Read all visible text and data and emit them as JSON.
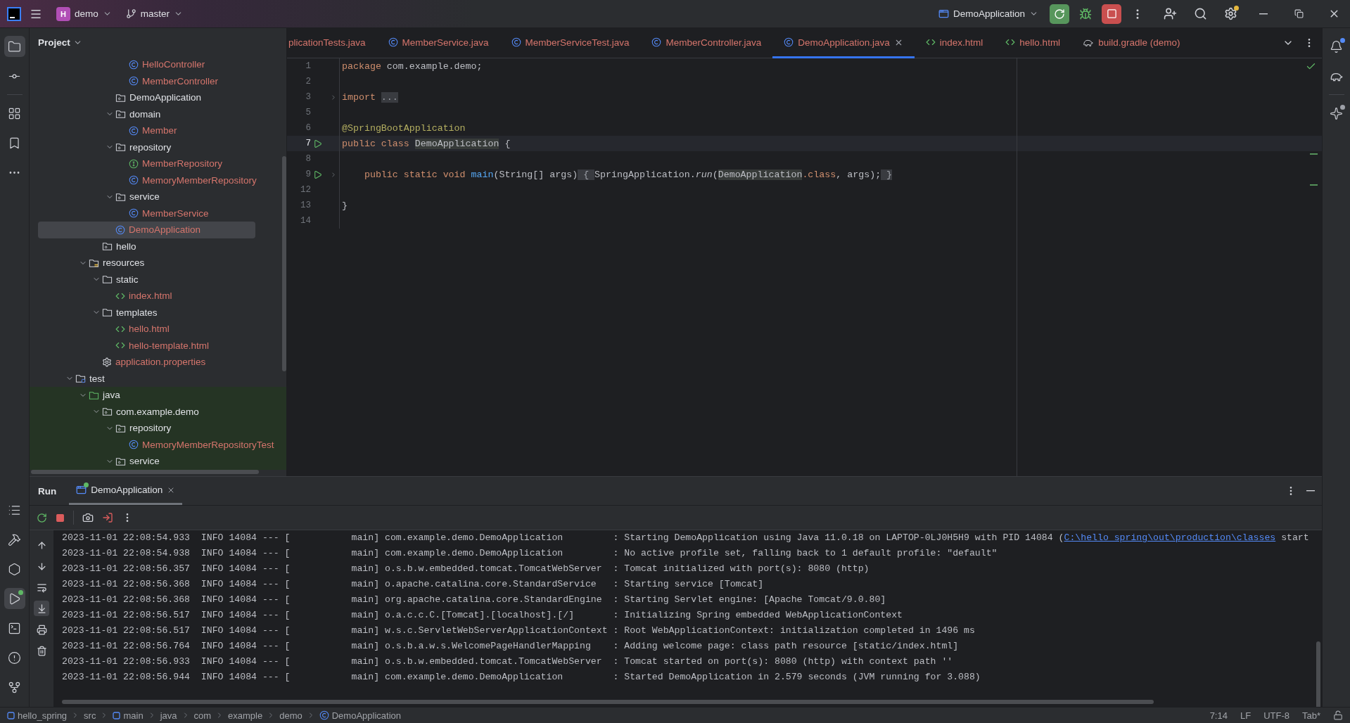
{
  "title_bar": {
    "project_badge": "H",
    "project": "demo",
    "branch": "master",
    "run_config": "DemoApplication"
  },
  "left_tools": [
    {
      "kind": "folder",
      "selected": true,
      "running": false
    },
    {
      "kind": "commit",
      "selected": false,
      "running": false
    },
    {
      "kind": "structure",
      "selected": false,
      "running": false
    },
    {
      "kind": "bookmark",
      "selected": false,
      "running": false
    },
    {
      "kind": "more",
      "selected": false,
      "running": false
    }
  ],
  "left_tools_bottom": [
    {
      "kind": "list",
      "selected": false,
      "running": false
    },
    {
      "kind": "build",
      "selected": false,
      "running": false
    },
    {
      "kind": "services",
      "selected": false,
      "running": false
    },
    {
      "kind": "run",
      "selected": true,
      "running": true
    },
    {
      "kind": "terminal",
      "selected": false,
      "running": false
    },
    {
      "kind": "problems",
      "selected": false,
      "running": false
    },
    {
      "kind": "git",
      "selected": false,
      "running": false
    }
  ],
  "project_panel": {
    "title": "Project",
    "tree": [
      {
        "children": [
          {
            "children": [
              {
                "children": [
                  {
                    "children": [
                      {
                        "label": "HelloController",
                        "kind": "class",
                        "selected": false
                      },
                      {
                        "label": "MemberController",
                        "kind": "class",
                        "selected": false
                      }
                    ]
                  },
                  {
                    "label": "DemoApplication",
                    "kind": "package",
                    "selected": false
                  },
                  {
                    "label": "domain",
                    "kind": "package",
                    "expanded": true,
                    "selected": false,
                    "children": [
                      {
                        "label": "Member",
                        "kind": "class",
                        "selected": false
                      }
                    ]
                  },
                  {
                    "label": "repository",
                    "kind": "package",
                    "expanded": true,
                    "selected": false,
                    "children": [
                      {
                        "label": "MemberRepository",
                        "kind": "interface",
                        "selected": false
                      },
                      {
                        "label": "MemoryMemberRepository",
                        "kind": "class",
                        "selected": false
                      }
                    ]
                  },
                  {
                    "label": "service",
                    "kind": "package",
                    "expanded": true,
                    "selected": false,
                    "children": [
                      {
                        "label": "MemberService",
                        "kind": "class",
                        "selected": false
                      }
                    ]
                  },
                  {
                    "label": "DemoApplication",
                    "kind": "class",
                    "selected": true
                  }
                ]
              },
              {
                "label": "hello",
                "kind": "package",
                "selected": false
              }
            ]
          },
          {
            "label": "resources",
            "kind": "resources",
            "expanded": true,
            "selected": false,
            "children": [
              {
                "label": "static",
                "kind": "folder",
                "expanded": true,
                "selected": false,
                "children": [
                  {
                    "label": "index.html",
                    "kind": "html",
                    "selected": false
                  }
                ]
              },
              {
                "label": "templates",
                "kind": "folder",
                "expanded": true,
                "selected": false,
                "children": [
                  {
                    "label": "hello.html",
                    "kind": "html",
                    "selected": false
                  },
                  {
                    "label": "hello-template.html",
                    "kind": "html",
                    "selected": false
                  }
                ]
              },
              {
                "label": "application.properties",
                "kind": "settings",
                "selected": false
              }
            ]
          }
        ]
      },
      {
        "label": "test",
        "kind": "test_root",
        "expanded": true,
        "selected": false,
        "children": [
          {
            "label": "java",
            "kind": "test_sources",
            "expanded": true,
            "selected": false,
            "children": [
              {
                "label": "com.example.demo",
                "kind": "package",
                "expanded": true,
                "selected": false,
                "children": [
                  {
                    "label": "repository",
                    "kind": "package",
                    "expanded": true,
                    "selected": false,
                    "children": [
                      {
                        "label": "MemoryMemberRepositoryTest",
                        "kind": "class",
                        "selected": false
                      }
                    ]
                  },
                  {
                    "label": "service",
                    "kind": "package",
                    "expanded": true,
                    "selected": false
                  }
                ]
              }
            ]
          }
        ]
      }
    ]
  },
  "editor": {
    "tabs": [
      {
        "label": "plicationTests.java",
        "selected": false
      },
      {
        "label": "MemberService.java",
        "kind": "class",
        "selected": false
      },
      {
        "label": "MemberServiceTest.java",
        "kind": "class",
        "selected": false
      },
      {
        "label": "MemberController.java",
        "kind": "class",
        "selected": false
      },
      {
        "label": "DemoApplication.java",
        "kind": "class",
        "selected": true
      },
      {
        "label": "index.html",
        "kind": "html",
        "selected": false
      },
      {
        "label": "hello.html",
        "kind": "html",
        "selected": false
      },
      {
        "label": "build.gradle (demo)",
        "kind": "gradle",
        "selected": false
      }
    ],
    "lines": [
      {
        "number": "1",
        "current": false,
        "runnable": false,
        "foldable": false,
        "tokens": [
          {
            "kind": "keyword",
            "text": "package"
          },
          {
            "kind": "plain",
            "text": " com.example.demo;"
          }
        ]
      },
      {
        "number": "2",
        "current": false,
        "runnable": false,
        "foldable": false
      },
      {
        "number": "3",
        "current": false,
        "runnable": false,
        "foldable": true,
        "tokens": [
          {
            "kind": "keyword",
            "text": "import "
          },
          {
            "kind": "fold",
            "text": "..."
          }
        ]
      },
      {
        "number": "5",
        "current": false,
        "runnable": false,
        "foldable": false
      },
      {
        "number": "6",
        "current": false,
        "runnable": false,
        "foldable": false,
        "tokens": [
          {
            "kind": "annotation",
            "text": "@SpringBootApplication"
          }
        ]
      },
      {
        "number": "7",
        "current": true,
        "runnable": true,
        "foldable": false,
        "tokens": [
          {
            "kind": "keyword",
            "text": "public class "
          },
          {
            "kind": "usage",
            "text": "DemoApplication"
          },
          {
            "kind": "plain",
            "text": " {"
          }
        ]
      },
      {
        "number": "8",
        "current": false,
        "runnable": false,
        "foldable": false
      },
      {
        "number": "9",
        "current": false,
        "runnable": true,
        "foldable": true,
        "tokens": [
          {
            "kind": "keyword",
            "text": "    public static void "
          },
          {
            "kind": "method",
            "text": "main"
          },
          {
            "kind": "plain",
            "text": "(String[] args)"
          },
          {
            "kind": "fold",
            "text": " { "
          },
          {
            "kind": "plain",
            "text": "SpringApplication."
          },
          {
            "kind": "static_call",
            "text": "run"
          },
          {
            "kind": "plain",
            "text": "("
          },
          {
            "kind": "usage",
            "text": "DemoApplication"
          },
          {
            "kind": "keyword",
            "text": ".class"
          },
          {
            "kind": "plain",
            "text": ", args);"
          },
          {
            "kind": "fold",
            "text": " }"
          }
        ]
      },
      {
        "number": "12",
        "current": false,
        "runnable": false,
        "foldable": false
      },
      {
        "number": "13",
        "current": false,
        "runnable": false,
        "foldable": false,
        "tokens": [
          {
            "kind": "plain",
            "text": "}"
          }
        ]
      },
      {
        "number": "14",
        "current": false,
        "runnable": false,
        "foldable": false
      }
    ]
  },
  "right_tools": [
    {
      "kind": "bell",
      "badge": true
    },
    {
      "kind": "gradle",
      "badge": false
    },
    {
      "kind": "ai",
      "badge": true
    }
  ],
  "run_panel": {
    "title": "Run",
    "tabs": [
      {
        "label": "DemoApplication",
        "selected": true,
        "running": true
      }
    ],
    "log": [
      {
        "text": "2023-11-01 22:08:54.933  INFO 14084 --- [           main] com.example.demo.DemoApplication         : Starting DemoApplication using Java 11.0.18 on LAPTOP-0LJ0H5H9 with PID 14084 (",
        "link": "C:\\hello_spring\\out\\production\\classes",
        "tail": " start"
      },
      {
        "text": "2023-11-01 22:08:54.938  INFO 14084 --- [           main] com.example.demo.DemoApplication         : No active profile set, falling back to 1 default profile: \"default\""
      },
      {
        "text": "2023-11-01 22:08:56.357  INFO 14084 --- [           main] o.s.b.w.embedded.tomcat.TomcatWebServer  : Tomcat initialized with port(s): 8080 (http)"
      },
      {
        "text": "2023-11-01 22:08:56.368  INFO 14084 --- [           main] o.apache.catalina.core.StandardService   : Starting service [Tomcat]"
      },
      {
        "text": "2023-11-01 22:08:56.368  INFO 14084 --- [           main] org.apache.catalina.core.StandardEngine  : Starting Servlet engine: [Apache Tomcat/9.0.80]"
      },
      {
        "text": "2023-11-01 22:08:56.517  INFO 14084 --- [           main] o.a.c.c.C.[Tomcat].[localhost].[/]       : Initializing Spring embedded WebApplicationContext"
      },
      {
        "text": "2023-11-01 22:08:56.517  INFO 14084 --- [           main] w.s.c.ServletWebServerApplicationContext : Root WebApplicationContext: initialization completed in 1496 ms"
      },
      {
        "text": "2023-11-01 22:08:56.764  INFO 14084 --- [           main] o.s.b.a.w.s.WelcomePageHandlerMapping    : Adding welcome page: class path resource [static/index.html]"
      },
      {
        "text": "2023-11-01 22:08:56.933  INFO 14084 --- [           main] o.s.b.w.embedded.tomcat.TomcatWebServer  : Tomcat started on port(s): 8080 (http) with context path ''"
      },
      {
        "text": "2023-11-01 22:08:56.944  INFO 14084 --- [           main] com.example.demo.DemoApplication         : Started DemoApplication in 2.579 seconds (JVM running for 3.088)"
      }
    ]
  },
  "status_bar": {
    "breadcrumbs": [
      {
        "label": "hello_spring",
        "kind": "module"
      },
      {
        "label": "src"
      },
      {
        "label": "main",
        "kind": "module"
      },
      {
        "label": "java"
      },
      {
        "label": "com"
      },
      {
        "label": "example"
      },
      {
        "label": "demo"
      },
      {
        "label": "DemoApplication",
        "kind": "class"
      }
    ],
    "position": "7:14",
    "line_ending": "LF",
    "encoding": "UTF-8",
    "indent": "Tab*"
  }
}
